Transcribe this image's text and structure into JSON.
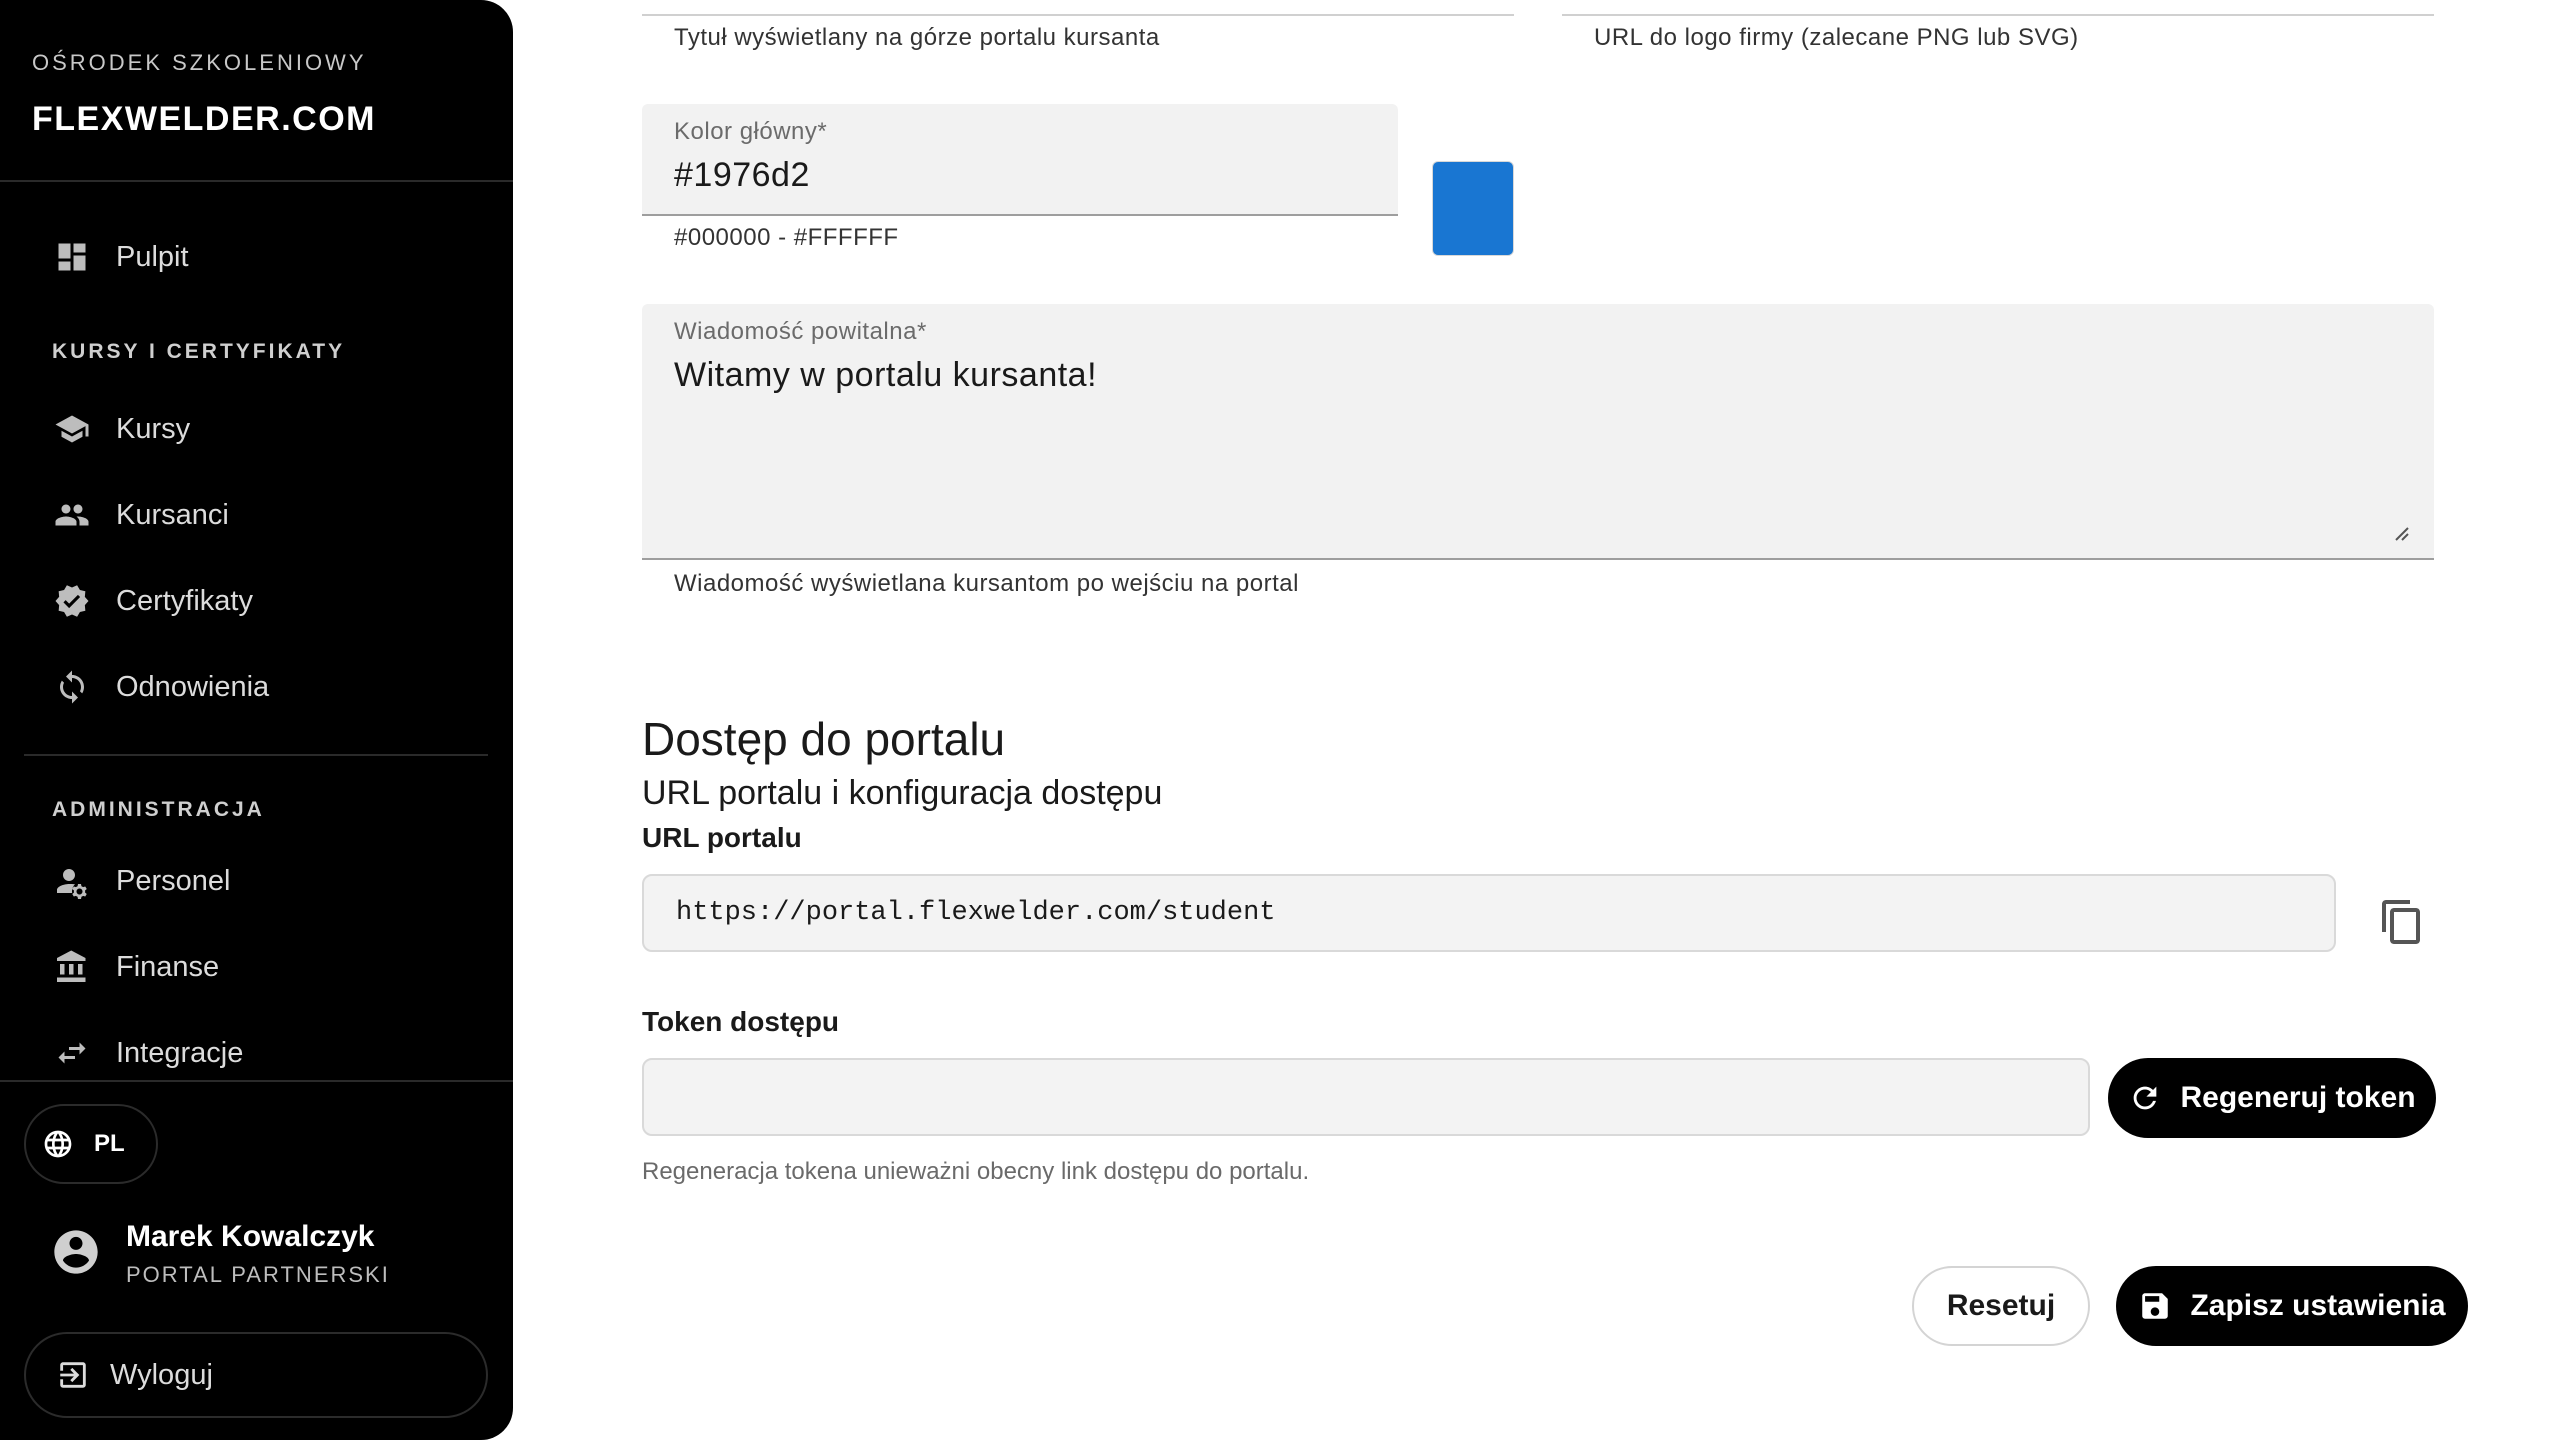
{
  "sidebar": {
    "brand_sub": "OŚRODEK SZKOLENIOWY",
    "brand_name": "FLEXWELDER.COM",
    "dashboard": "Pulpit",
    "section_courses": "KURSY I CERTYFIKATY",
    "courses": "Kursy",
    "students": "Kursanci",
    "certificates": "Certyfikaty",
    "renewals": "Odnowienia",
    "section_admin": "ADMINISTRACJA",
    "staff": "Personel",
    "finance": "Finanse",
    "integrations": "Integracje",
    "language": "PL",
    "user_name": "Marek Kowalczyk",
    "user_role": "PORTAL PARTNERSKI",
    "logout": "Wyloguj"
  },
  "form": {
    "title_helper": "Tytuł wyświetlany na górze portalu kursanta",
    "logo_helper": "URL do logo firmy (zalecane PNG lub SVG)",
    "primary_color_label": "Kolor główny*",
    "primary_color_value": "#1976d2",
    "primary_color_helper": "#000000 - #FFFFFF",
    "swatch_color": "#1976d2",
    "welcome_label": "Wiadomość powitalna*",
    "welcome_value": "Witamy w portalu kursanta!",
    "welcome_helper": "Wiadomość wyświetlana kursantom po wejściu na portal"
  },
  "access": {
    "heading": "Dostęp do portalu",
    "subheading": "URL portalu i konfiguracja dostępu",
    "url_label": "URL portalu",
    "url_value": "https://portal.flexwelder.com/student",
    "token_label": "Token dostępu",
    "token_value": "",
    "regenerate": "Regeneruj token",
    "note": "Regeneracja tokena unieważni obecny link dostępu do portalu."
  },
  "actions": {
    "reset": "Resetuj",
    "save": "Zapisz ustawienia"
  }
}
